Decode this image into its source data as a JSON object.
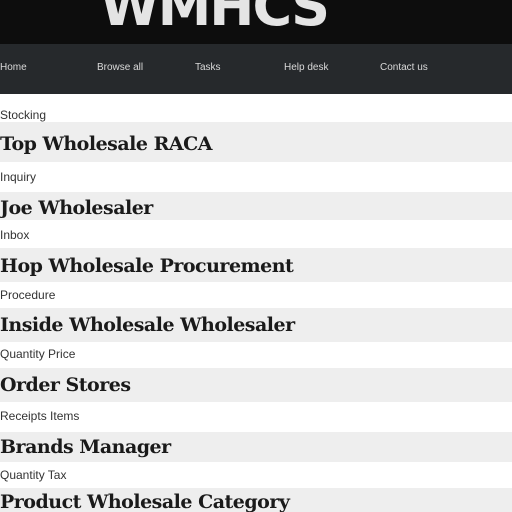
{
  "header": {
    "title": "WMHCS"
  },
  "nav": {
    "items": [
      {
        "label": "Home"
      },
      {
        "label": "Browse all"
      },
      {
        "label": "Tasks"
      },
      {
        "label": "Help desk"
      },
      {
        "label": "Contact us"
      }
    ]
  },
  "list": {
    "rows": [
      {
        "label": "Stocking"
      },
      {
        "label": "Top Wholesale RACA"
      },
      {
        "label": "Inquiry"
      },
      {
        "label": "Joe Wholesaler"
      },
      {
        "label": "Inbox"
      },
      {
        "label": "Hop Wholesale Procurement"
      },
      {
        "label": "Procedure"
      },
      {
        "label": "Inside Wholesale Wholesaler"
      },
      {
        "label": "Quantity Price"
      },
      {
        "label": "Order Stores"
      },
      {
        "label": "Receipts Items"
      },
      {
        "label": "Brands Manager"
      },
      {
        "label": "Quantity Tax"
      },
      {
        "label": "Product Wholesale Category"
      }
    ]
  }
}
